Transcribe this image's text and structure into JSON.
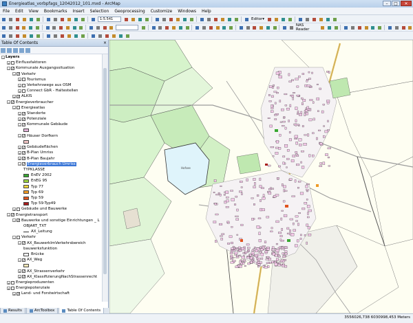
{
  "window": {
    "title": "Energieatlas_vorbpfags_12042012_101.mxd - ArcMap",
    "buttons": [
      "–",
      "□",
      "✕"
    ]
  },
  "menu": [
    "File",
    "Edit",
    "View",
    "Bookmarks",
    "Insert",
    "Selection",
    "Geoprocessing",
    "Customize",
    "Windows",
    "Help"
  ],
  "toolbar": {
    "scale": "1:5.541",
    "editor_label": "Editor▾",
    "nas_reader_label": "NAS Reader"
  },
  "toc": {
    "title": "Table Of Contents",
    "close": "×",
    "rows": [
      {
        "indent": 0,
        "exp": "−",
        "cb": null,
        "label": "Layers",
        "bold": true
      },
      {
        "indent": 1,
        "exp": "+",
        "cb": false,
        "label": "Einflussfaktoren"
      },
      {
        "indent": 1,
        "exp": "−",
        "cb": true,
        "label": "Kommunale Ausgangssituation"
      },
      {
        "indent": 2,
        "exp": "−",
        "cb": true,
        "label": "Verkehr"
      },
      {
        "indent": 3,
        "exp": "+",
        "cb": false,
        "label": "Tourismus"
      },
      {
        "indent": 3,
        "exp": "+",
        "cb": false,
        "label": "Verkehrswege aus OSM"
      },
      {
        "indent": 3,
        "exp": "+",
        "cb": false,
        "label": "Connect GbR - Haltestellen"
      },
      {
        "indent": 2,
        "exp": "+",
        "cb": true,
        "label": "ALKIS"
      },
      {
        "indent": 1,
        "exp": "−",
        "cb": true,
        "label": "Energieverbraucher"
      },
      {
        "indent": 2,
        "exp": "−",
        "cb": false,
        "label": "Energieatlas"
      },
      {
        "indent": 3,
        "exp": "+",
        "cb": true,
        "label": "Standorte"
      },
      {
        "indent": 3,
        "exp": "+",
        "cb": true,
        "label": "Potenziale"
      },
      {
        "indent": 3,
        "exp": "−",
        "cb": true,
        "label": "Kommunale Gebäude"
      },
      {
        "indent": 4,
        "swatch": "#e2b3d8",
        "label": ""
      },
      {
        "indent": 3,
        "exp": "−",
        "cb": true,
        "label": "Häuser Dorfkern"
      },
      {
        "indent": 4,
        "swatch": "#f2c6c6",
        "label": ""
      },
      {
        "indent": 3,
        "exp": "+",
        "cb": true,
        "label": "Gebäudeflächen"
      },
      {
        "indent": 3,
        "exp": "+",
        "cb": true,
        "label": "B-Plan Umriss"
      },
      {
        "indent": 3,
        "exp": "+",
        "cb": true,
        "label": "B-Plan Baujahr"
      },
      {
        "indent": 3,
        "exp": "−",
        "cb": true,
        "label": "Energieverbrauch Umriss",
        "selected": true
      },
      {
        "indent": 4,
        "label": "TYPKLASSE"
      },
      {
        "indent": 4,
        "swatch": "#39a832",
        "label": "EnEV 2002"
      },
      {
        "indent": 4,
        "swatch": "#9bd23c",
        "label": "EnEG 95"
      },
      {
        "indent": 4,
        "swatch": "#f0d43a",
        "label": "Typ 77"
      },
      {
        "indent": 4,
        "swatch": "#ef9a25",
        "label": "Typ 69"
      },
      {
        "indent": 4,
        "swatch": "#e0541d",
        "label": "Typ 59"
      },
      {
        "indent": 4,
        "swatch": "#a81c1c",
        "label": "Typ 59-Typ49"
      },
      {
        "indent": 2,
        "exp": "+",
        "cb": false,
        "label": "Gebäude und Bauwerke"
      },
      {
        "indent": 1,
        "exp": "−",
        "cb": true,
        "label": "Energietransport"
      },
      {
        "indent": 2,
        "exp": "−",
        "cb": true,
        "label": "Bauwerke und sonstige Einrichtungen _ L"
      },
      {
        "indent": 4,
        "label": "OBJART_TXT"
      },
      {
        "indent": 4,
        "line": true,
        "label": "AX_Leitung"
      },
      {
        "indent": 2,
        "exp": "−",
        "cb": false,
        "label": "Verkehr"
      },
      {
        "indent": 3,
        "exp": "−",
        "cb": true,
        "label": "AX_BauwerkImVerkehrsbereich"
      },
      {
        "indent": 4,
        "label": "bauwerksfunktion"
      },
      {
        "indent": 4,
        "swatch": "#ffffff",
        "label": "Brücke"
      },
      {
        "indent": 3,
        "exp": "−",
        "cb": true,
        "label": "AX_Weg"
      },
      {
        "indent": 4,
        "swatch": "#f5e7b8",
        "label": ""
      },
      {
        "indent": 3,
        "exp": "+",
        "cb": true,
        "label": "AX_Strassenverkehr"
      },
      {
        "indent": 3,
        "exp": "+",
        "cb": true,
        "label": "AX_KlassifizierungNachStrassenrecht"
      },
      {
        "indent": 1,
        "exp": "+",
        "cb": false,
        "label": "Energieproduzenten"
      },
      {
        "indent": 1,
        "exp": "+",
        "cb": false,
        "label": "Energiepotenziale"
      },
      {
        "indent": 2,
        "exp": "+",
        "cb": true,
        "label": "Land- und Forstwirtschaft"
      }
    ]
  },
  "map": {
    "lake_label": "Hofsee",
    "colors": {
      "field": "#fefef2",
      "green": "#d2f2c6",
      "green_dark": "#bfe8b0",
      "building": "#f3c8e8",
      "road": "#9b9b9b",
      "yellow_road": "#e9c66a",
      "lake": "#dff4fb",
      "gray_area": "#e5e5e5"
    }
  },
  "tabs": [
    {
      "label": "Results",
      "active": false
    },
    {
      "label": "ArcToolbox",
      "active": false
    },
    {
      "label": "Table Of Contents",
      "active": true
    }
  ],
  "status": {
    "coords": "3556026,738  6030998,453 Meters"
  }
}
